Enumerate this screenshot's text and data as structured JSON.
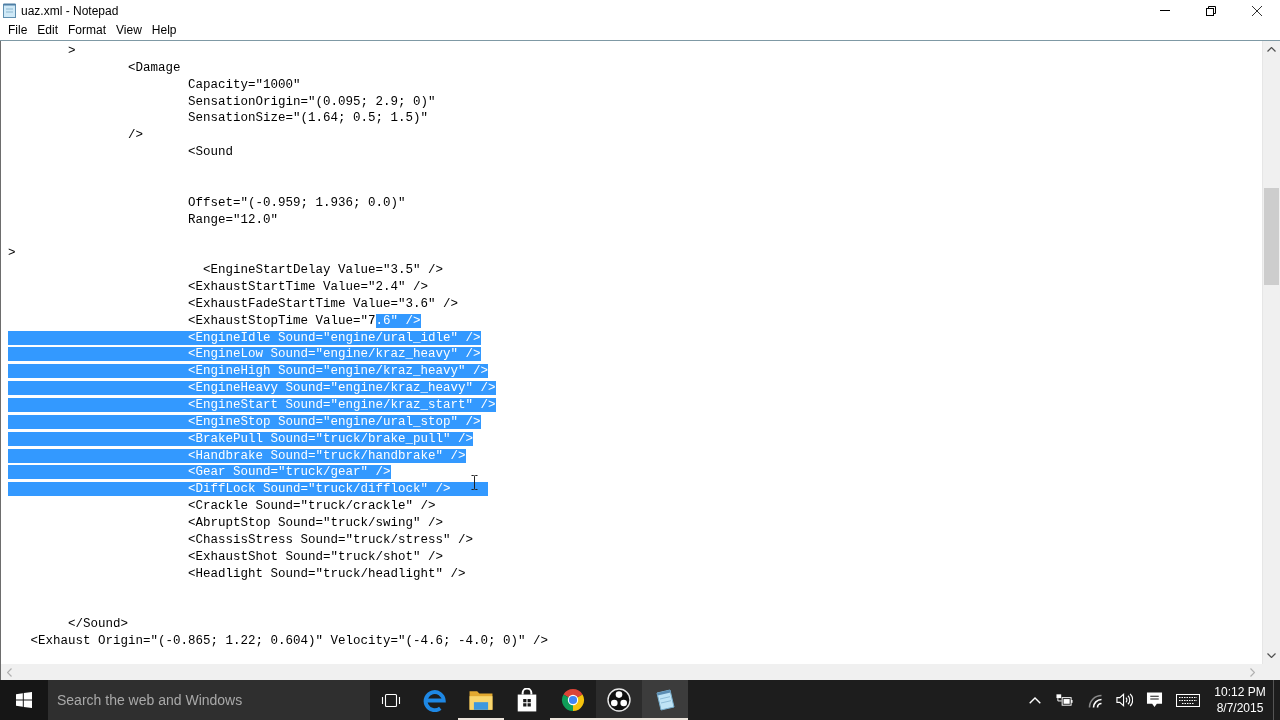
{
  "window": {
    "title": "uaz.xml - Notepad"
  },
  "menu": [
    "File",
    "Edit",
    "Format",
    "View",
    "Help"
  ],
  "editor": {
    "lines": [
      {
        "kind": "code",
        "segments": [
          {
            "text": "\t>",
            "selected": false
          }
        ]
      },
      {
        "kind": "code",
        "segments": [
          {
            "text": "\t\t<Damage",
            "selected": false
          }
        ]
      },
      {
        "kind": "code",
        "segments": [
          {
            "text": "\t\t\tCapacity=\"1000\"",
            "selected": false
          }
        ]
      },
      {
        "kind": "code",
        "segments": [
          {
            "text": "\t\t\tSensationOrigin=\"(0.095; 2.9; 0)\"",
            "selected": false
          }
        ]
      },
      {
        "kind": "code",
        "segments": [
          {
            "text": "\t\t\tSensationSize=\"(1.64; 0.5; 1.5)\"",
            "selected": false
          }
        ]
      },
      {
        "kind": "code",
        "segments": [
          {
            "text": "\t\t/>",
            "selected": false
          }
        ]
      },
      {
        "kind": "code",
        "segments": [
          {
            "text": "\t\t\t<Sound",
            "selected": false
          }
        ]
      },
      {
        "kind": "blank"
      },
      {
        "kind": "blank"
      },
      {
        "kind": "code",
        "segments": [
          {
            "text": "\t\t\tOffset=\"(-0.959; 1.936; 0.0)\"",
            "selected": false
          }
        ]
      },
      {
        "kind": "code",
        "segments": [
          {
            "text": "\t\t\tRange=\"12.0\"",
            "selected": false
          }
        ]
      },
      {
        "kind": "blank"
      },
      {
        "kind": "code",
        "segments": [
          {
            "text": ">",
            "selected": false
          }
        ]
      },
      {
        "kind": "code",
        "segments": [
          {
            "text": "\t\t\t  <EngineStartDelay Value=\"3.5\" />",
            "selected": false
          }
        ]
      },
      {
        "kind": "code",
        "segments": [
          {
            "text": "\t\t\t<ExhaustStartTime Value=\"2.4\" />",
            "selected": false
          }
        ]
      },
      {
        "kind": "code",
        "segments": [
          {
            "text": "\t\t\t<ExhaustFadeStartTime Value=\"3.6\" />",
            "selected": false
          }
        ]
      },
      {
        "kind": "code",
        "segments": [
          {
            "text": "\t\t\t<ExhaustStopTime Value=\"7",
            "selected": false
          },
          {
            "text": ".6\" />",
            "selected": true
          }
        ]
      },
      {
        "kind": "code",
        "segments": [
          {
            "text": "\t\t\t<EngineIdle Sound=\"engine/ural_idle\" />",
            "selected": true
          }
        ]
      },
      {
        "kind": "code",
        "segments": [
          {
            "text": "\t\t\t<EngineLow Sound=\"engine/kraz_heavy\" />",
            "selected": true
          }
        ]
      },
      {
        "kind": "code",
        "segments": [
          {
            "text": "\t\t\t<EngineHigh Sound=\"engine/kraz_heavy\" />",
            "selected": true
          }
        ]
      },
      {
        "kind": "code",
        "segments": [
          {
            "text": "\t\t\t<EngineHeavy Sound=\"engine/kraz_heavy\" />",
            "selected": true
          }
        ]
      },
      {
        "kind": "code",
        "segments": [
          {
            "text": "\t\t\t<EngineStart Sound=\"engine/kraz_start\" />",
            "selected": true
          }
        ]
      },
      {
        "kind": "code",
        "segments": [
          {
            "text": "\t\t\t<EngineStop Sound=\"engine/ural_stop\" />",
            "selected": true
          }
        ]
      },
      {
        "kind": "code",
        "segments": [
          {
            "text": "\t\t\t<BrakePull Sound=\"truck/brake_pull\" />",
            "selected": true
          }
        ]
      },
      {
        "kind": "code",
        "segments": [
          {
            "text": "\t\t\t<Handbrake Sound=\"truck/handbrake\" />",
            "selected": true
          }
        ]
      },
      {
        "kind": "code",
        "segments": [
          {
            "text": "\t\t\t<Gear Sound=\"truck/gear\" />",
            "selected": true
          }
        ]
      },
      {
        "kind": "code",
        "segments": [
          {
            "text": "\t\t\t<DiffLock Sound=\"truck/difflock\" />     ",
            "selected": true
          }
        ]
      },
      {
        "kind": "code",
        "segments": [
          {
            "text": "\t\t\t<Crackle Sound=\"truck/crackle\" />",
            "selected": false
          }
        ]
      },
      {
        "kind": "code",
        "segments": [
          {
            "text": "\t\t\t<AbruptStop Sound=\"truck/swing\" />",
            "selected": false
          }
        ]
      },
      {
        "kind": "code",
        "segments": [
          {
            "text": "\t\t\t<ChassisStress Sound=\"truck/stress\" />",
            "selected": false
          }
        ]
      },
      {
        "kind": "code",
        "segments": [
          {
            "text": "\t\t\t<ExhaustShot Sound=\"truck/shot\" />",
            "selected": false
          }
        ]
      },
      {
        "kind": "code",
        "segments": [
          {
            "text": "\t\t\t<Headlight Sound=\"truck/headlight\" />",
            "selected": false
          }
        ]
      },
      {
        "kind": "blank"
      },
      {
        "kind": "blank"
      },
      {
        "kind": "code",
        "segments": [
          {
            "text": "\t</Sound>",
            "selected": false
          }
        ]
      },
      {
        "kind": "code",
        "segments": [
          {
            "text": "   <Exhaust Origin=\"(-0.865; 1.22; 0.604)\" Velocity=\"(-4.6; -4.0; 0)\" />",
            "selected": false
          }
        ]
      }
    ]
  },
  "taskbar": {
    "search": {
      "placeholder": "Search the web and Windows"
    },
    "apps": [
      {
        "kind": "edge",
        "running": false,
        "hovered": false,
        "selected": false
      },
      {
        "kind": "explorer",
        "running": true,
        "hovered": false,
        "selected": false
      },
      {
        "kind": "store",
        "running": false,
        "hovered": false,
        "selected": false
      },
      {
        "kind": "chrome",
        "running": true,
        "hovered": false,
        "selected": false
      },
      {
        "kind": "obs",
        "running": true,
        "hovered": true,
        "selected": false
      },
      {
        "kind": "notepad",
        "running": true,
        "hovered": false,
        "selected": true
      }
    ],
    "clock": {
      "time": "10:12 PM",
      "date": "8/7/2015"
    }
  }
}
